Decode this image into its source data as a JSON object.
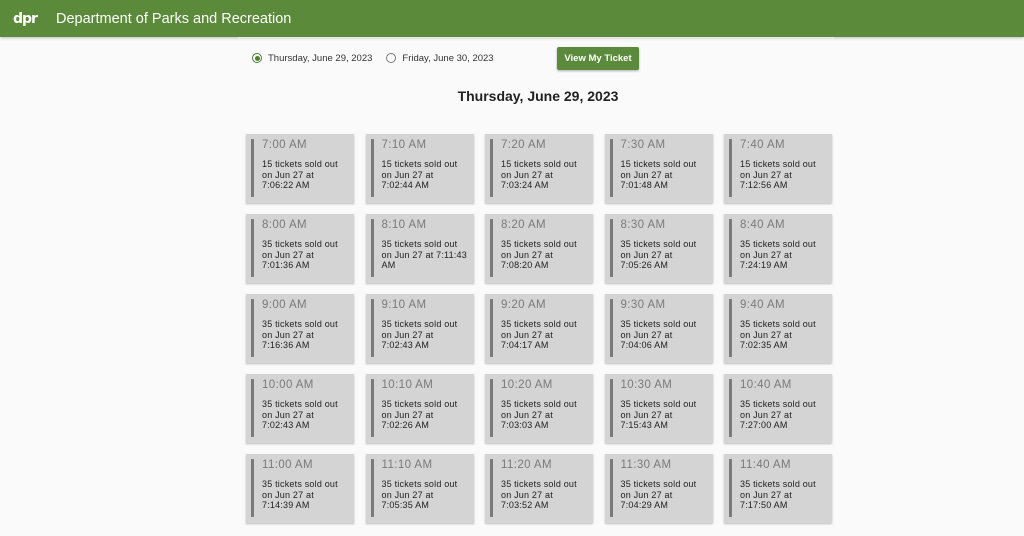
{
  "header": {
    "logo_text": "dpr",
    "title": "Department of Parks and Recreation"
  },
  "date_options": [
    {
      "label": "Thursday, June 29, 2023",
      "selected": true
    },
    {
      "label": "Friday, June 30, 2023",
      "selected": false
    }
  ],
  "view_ticket_label": "View My Ticket",
  "day_heading": "Thursday, June 29, 2023",
  "slots": [
    {
      "time": "7:00 AM",
      "info": "15 tickets sold out on Jun 27 at 7:06:22 AM"
    },
    {
      "time": "7:10 AM",
      "info": "15 tickets sold out on Jun 27 at 7:02:44 AM"
    },
    {
      "time": "7:20 AM",
      "info": "15 tickets sold out on Jun 27 at 7:03:24 AM"
    },
    {
      "time": "7:30 AM",
      "info": "15 tickets sold out on Jun 27 at 7:01:48 AM"
    },
    {
      "time": "7:40 AM",
      "info": "15 tickets sold out on Jun 27 at 7:12:56 AM"
    },
    {
      "time": "8:00 AM",
      "info": "35 tickets sold out on Jun 27 at 7:01:36 AM"
    },
    {
      "time": "8:10 AM",
      "info": "35 tickets sold out on Jun 27 at 7:11:43 AM"
    },
    {
      "time": "8:20 AM",
      "info": "35 tickets sold out on Jun 27 at 7:08:20 AM"
    },
    {
      "time": "8:30 AM",
      "info": "35 tickets sold out on Jun 27 at 7:05:26 AM"
    },
    {
      "time": "8:40 AM",
      "info": "35 tickets sold out on Jun 27 at 7:24:19 AM"
    },
    {
      "time": "9:00 AM",
      "info": "35 tickets sold out on Jun 27 at 7:16:36 AM"
    },
    {
      "time": "9:10 AM",
      "info": "35 tickets sold out on Jun 27 at 7:02:43 AM"
    },
    {
      "time": "9:20 AM",
      "info": "35 tickets sold out on Jun 27 at 7:04:17 AM"
    },
    {
      "time": "9:30 AM",
      "info": "35 tickets sold out on Jun 27 at 7:04:06 AM"
    },
    {
      "time": "9:40 AM",
      "info": "35 tickets sold out on Jun 27 at 7:02:35 AM"
    },
    {
      "time": "10:00 AM",
      "info": "35 tickets sold out on Jun 27 at 7:02:43 AM"
    },
    {
      "time": "10:10 AM",
      "info": "35 tickets sold out on Jun 27 at 7:02:26 AM"
    },
    {
      "time": "10:20 AM",
      "info": "35 tickets sold out on Jun 27 at 7:03:03 AM"
    },
    {
      "time": "10:30 AM",
      "info": "35 tickets sold out on Jun 27 at 7:15:43 AM"
    },
    {
      "time": "10:40 AM",
      "info": "35 tickets sold out on Jun 27 at 7:27:00 AM"
    },
    {
      "time": "11:00 AM",
      "info": "35 tickets sold out on Jun 27 at 7:14:39 AM"
    },
    {
      "time": "11:10 AM",
      "info": "35 tickets sold out on Jun 27 at 7:05:35 AM"
    },
    {
      "time": "11:20 AM",
      "info": "35 tickets sold out on Jun 27 at 7:03:52 AM"
    },
    {
      "time": "11:30 AM",
      "info": "35 tickets sold out on Jun 27 at 7:04:29 AM"
    },
    {
      "time": "11:40 AM",
      "info": "35 tickets sold out on Jun 27 at 7:17:50 AM"
    }
  ],
  "colors": {
    "header_green": "#5a8a3a",
    "button_green": "#5b8a3c",
    "slot_gray": "#d4d4d4"
  }
}
